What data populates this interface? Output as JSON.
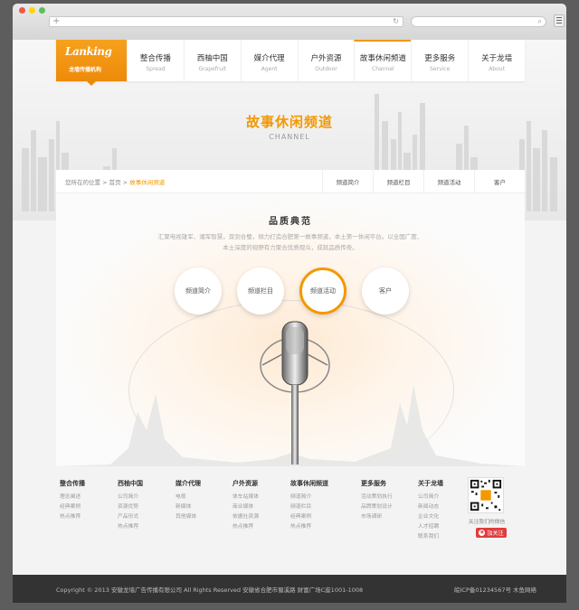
{
  "nav": {
    "logo_mark": "Lanking",
    "logo_cn": "龙墙传播机构",
    "items": [
      {
        "title": "整合传播",
        "sub": "Spread"
      },
      {
        "title": "西柚中国",
        "sub": "Grapefruit"
      },
      {
        "title": "媒介代理",
        "sub": "Agent"
      },
      {
        "title": "户外资源",
        "sub": "Outdoor"
      },
      {
        "title": "故事休闲频道",
        "sub": "Channel"
      },
      {
        "title": "更多服务",
        "sub": "Service"
      },
      {
        "title": "关于龙墙",
        "sub": "About"
      }
    ]
  },
  "hero": {
    "title": "故事休闲频道",
    "subtitle": "CHANNEL"
  },
  "breadcrumb": {
    "prefix": "您所在的位置",
    "sep": " > ",
    "home": "首页",
    "current": "故事休闲频道"
  },
  "subnav": [
    "频道简介",
    "频道栏目",
    "频道活动",
    "客户"
  ],
  "content": {
    "title": "品质典范",
    "desc_line1": "汇聚电视雄军、湘军智慧，双剑合璧，倾力打造合肥第一故事频道，本土第一休闲平台。以全国广度、",
    "desc_line2": "本土深度的视野有力聚合优质观众，成就品质传奇。",
    "circles": [
      "频道简介",
      "频道栏目",
      "频道活动",
      "客户"
    ]
  },
  "footer": {
    "columns": [
      {
        "head": "整合传播",
        "links": [
          "理念阐述",
          "经典案例",
          "热点推荐"
        ]
      },
      {
        "head": "西柚中国",
        "links": [
          "公司简介",
          "资源优势",
          "产品形式",
          "热点推荐"
        ]
      },
      {
        "head": "媒介代理",
        "links": [
          "电视",
          "新媒体",
          "其他媒体"
        ]
      },
      {
        "head": "户外资源",
        "links": [
          "体车站媒体",
          "商业媒体",
          "依据社资源",
          "热点推荐"
        ]
      },
      {
        "head": "故事休闲频道",
        "links": [
          "频道简介",
          "频道栏目",
          "经典案例",
          "热点推荐"
        ]
      },
      {
        "head": "更多服务",
        "links": [
          "活动策划执行",
          "品牌策划设计",
          "市场调研"
        ]
      },
      {
        "head": "关于龙墙",
        "links": [
          "公司简介",
          "新闻动态",
          "企业文化",
          "人才招聘",
          "联系我们"
        ]
      }
    ],
    "qr_caption": "关注我们的微信",
    "follow_label": "加关注",
    "copyright": "Copyright © 2013 安徽龙墙广告传播有限公司  All Rights Reserved   安徽省合肥市蜀溪路  财富广场C座1001-1008",
    "icp": "皖ICP备01234567号   木鱼网络"
  },
  "colors": {
    "accent": "#f39800",
    "footer_bg": "#333333",
    "frame": "#5d5d5d"
  }
}
